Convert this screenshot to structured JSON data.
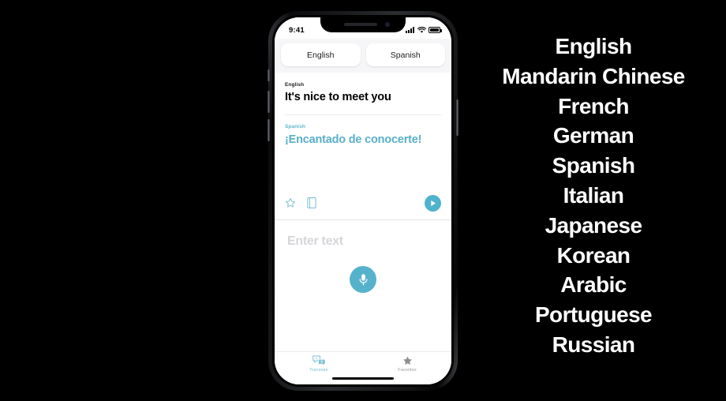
{
  "phone": {
    "status_bar": {
      "time": "9:41",
      "signal_icon": "cellular-bars-icon",
      "wifi_icon": "wifi-icon",
      "battery_icon": "battery-icon"
    },
    "hardware": {
      "mute_switch": "mute-switch",
      "volume_up": "volume-up-button",
      "volume_down": "volume-down-button",
      "power": "power-button",
      "speaker": "earpiece-speaker",
      "camera": "front-camera"
    }
  },
  "app": {
    "language_selector": {
      "source": "English",
      "target": "Spanish"
    },
    "translation_card": {
      "source_label": "English",
      "source_text": "It's nice to meet you",
      "target_label": "Spanish",
      "target_text": "¡Encantado de conocerte!",
      "actions": {
        "favorite_icon": "star-outline-icon",
        "dictionary_icon": "dictionary-icon",
        "play_icon": "play-icon"
      }
    },
    "input_area": {
      "placeholder": "Enter text",
      "mic_icon": "microphone-icon"
    },
    "tabs": [
      {
        "label": "Translate",
        "icon": "translate-bubbles-icon",
        "active": true
      },
      {
        "label": "Favorites",
        "icon": "star-filled-icon",
        "active": false
      }
    ]
  },
  "languages": [
    "English",
    "Mandarin Chinese",
    "French",
    "German",
    "Spanish",
    "Italian",
    "Japanese",
    "Korean",
    "Arabic",
    "Portuguese",
    "Russian"
  ],
  "colors": {
    "background": "#000000",
    "accent_teal": "#4eb3cc",
    "target_text": "#5aafc9",
    "placeholder": "#d6d6da"
  }
}
